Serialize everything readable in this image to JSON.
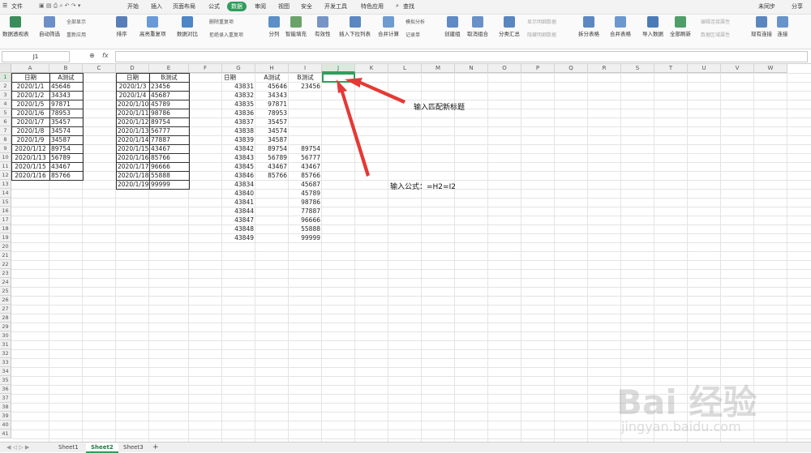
{
  "menu": {
    "file": "文件",
    "tabs": [
      "开始",
      "插入",
      "页面布局",
      "公式",
      "数据",
      "审阅",
      "视图",
      "安全",
      "开发工具",
      "特色应用"
    ],
    "active_tab": "数据",
    "search": "查找",
    "sync": "未同步",
    "share": "分享"
  },
  "ribbon": {
    "pivot": "数据透视表",
    "autofilter": "自动筛选",
    "show_all": "全部显示",
    "reapply": "重新应用",
    "sort": "排序",
    "highlight_dup": "高亮重复项",
    "compare": "数据对比",
    "remove_dup": "删除重复项",
    "reject_dup": "拒绝录入重复项",
    "split": "分列",
    "smart_fill": "智能填充",
    "validity": "有效性",
    "dropdown": "插入下拉列表",
    "consolidate": "合并计算",
    "whatif": "模拟分析",
    "record": "记录单",
    "group": "创建组",
    "ungroup": "取消组合",
    "subtotal": "分类汇总",
    "show_detail": "显示明细数据",
    "hide_detail": "隐藏明细数据",
    "split_table": "拆分表格",
    "merge_table": "合并表格",
    "import": "导入数据",
    "refresh_all": "全部刷新",
    "edit_query": "编辑连接属性",
    "area_attr": "数据区域属性",
    "existing_conn": "现有连接",
    "connect": "连接"
  },
  "formula_bar": {
    "name_box": "J1",
    "fx": "fx",
    "value": ""
  },
  "columns": [
    "A",
    "B",
    "C",
    "D",
    "E",
    "F",
    "G",
    "H",
    "I",
    "J",
    "K",
    "L",
    "M",
    "N",
    "O",
    "P",
    "Q",
    "R",
    "S",
    "T",
    "U",
    "V",
    "W"
  ],
  "selected_column": "J",
  "selected_cell": "J1",
  "table1": {
    "headers": [
      "日期",
      "A测试"
    ],
    "rows": [
      [
        "2020/1/1",
        "45646"
      ],
      [
        "2020/1/2",
        "34343"
      ],
      [
        "2020/1/5",
        "97871"
      ],
      [
        "2020/1/6",
        "78953"
      ],
      [
        "2020/1/7",
        "35457"
      ],
      [
        "2020/1/8",
        "34574"
      ],
      [
        "2020/1/9",
        "34587"
      ],
      [
        "2020/1/12",
        "89754"
      ],
      [
        "2020/1/13",
        "56789"
      ],
      [
        "2020/1/15",
        "43467"
      ],
      [
        "2020/1/16",
        "85766"
      ]
    ]
  },
  "table2": {
    "headers": [
      "日期",
      "B测试"
    ],
    "rows": [
      [
        "2020/1/3",
        "23456"
      ],
      [
        "2020/1/4",
        "45687"
      ],
      [
        "2020/1/10",
        "45789"
      ],
      [
        "2020/1/11",
        "98786"
      ],
      [
        "2020/1/12",
        "89754"
      ],
      [
        "2020/1/13",
        "56777"
      ],
      [
        "2020/1/14",
        "77887"
      ],
      [
        "2020/1/15",
        "43467"
      ],
      [
        "2020/1/16",
        "85766"
      ],
      [
        "2020/1/17",
        "96666"
      ],
      [
        "2020/1/18",
        "55888"
      ],
      [
        "2020/1/19",
        "99999"
      ]
    ]
  },
  "table3": {
    "headers": [
      "日期",
      "A测试",
      "B测试"
    ],
    "rows": [
      [
        "43831",
        "45646",
        "23456"
      ],
      [
        "43832",
        "34343",
        ""
      ],
      [
        "43835",
        "97871",
        ""
      ],
      [
        "43836",
        "78953",
        ""
      ],
      [
        "43837",
        "35457",
        ""
      ],
      [
        "43838",
        "34574",
        ""
      ],
      [
        "43839",
        "34587",
        ""
      ],
      [
        "43842",
        "89754",
        "89754"
      ],
      [
        "43843",
        "56789",
        "56777"
      ],
      [
        "43845",
        "43467",
        "43467"
      ],
      [
        "43846",
        "85766",
        "85766"
      ],
      [
        "43834",
        "",
        "45687"
      ],
      [
        "43840",
        "",
        "45789"
      ],
      [
        "43841",
        "",
        "98786"
      ],
      [
        "43844",
        "",
        "77887"
      ],
      [
        "43847",
        "",
        "96666"
      ],
      [
        "43848",
        "",
        "55888"
      ],
      [
        "43849",
        "",
        "99999"
      ]
    ]
  },
  "annotations": {
    "title_hint": "输入匹配新标题",
    "formula_hint": "输入公式：=H2=I2"
  },
  "sheets": [
    "Sheet1",
    "Sheet2",
    "Sheet3"
  ],
  "active_sheet": "Sheet2",
  "add_sheet": "+",
  "watermark": {
    "brand": "Bai 经验",
    "url": "jingyan.baidu.com"
  },
  "colors": {
    "accent": "#2f9e5b",
    "arrow": "#e53935"
  }
}
